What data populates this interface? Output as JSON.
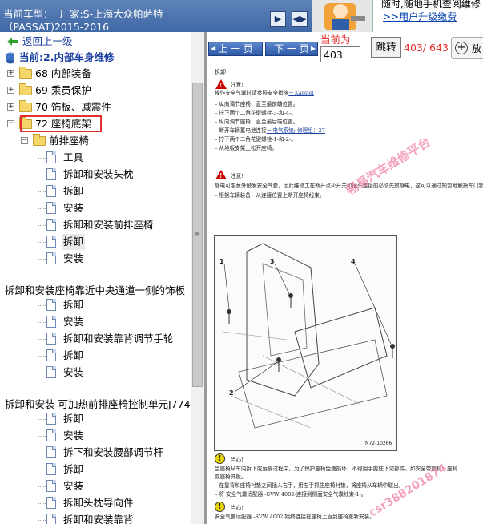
{
  "header": {
    "vehicle_line1": "当前车型：  厂家:S-上海大众帕萨特",
    "vehicle_line2": "（PASSAT)2015-2016",
    "promo_line1": "随时,随地手机查阅维修",
    "promo_line2": ">>用户升级缴费"
  },
  "tree": {
    "back_label": "返回上一级",
    "current_label": "当前:2.内部车身维修",
    "items": [
      {
        "label": "68 内部装备"
      },
      {
        "label": "69 乘员保护"
      },
      {
        "label": "70 饰板、减震件"
      },
      {
        "label": "72 座椅底架"
      },
      {
        "label": "前排座椅"
      },
      {
        "label": "工具"
      },
      {
        "label": "拆卸和安装头枕"
      },
      {
        "label": "拆卸"
      },
      {
        "label": "安装"
      },
      {
        "label": "拆卸和安装前排座椅"
      },
      {
        "label": "拆卸"
      },
      {
        "label": "安装"
      },
      {
        "label": "拆卸和安装座椅靠近中央通道一侧的饰板"
      },
      {
        "label": "拆卸"
      },
      {
        "label": "安装"
      },
      {
        "label": "拆卸和安装靠背调节手轮"
      },
      {
        "label": "拆卸"
      },
      {
        "label": "安装"
      },
      {
        "label": "拆卸和安装 可加热前排座椅控制单元J774"
      },
      {
        "label": "拆卸"
      },
      {
        "label": "安装"
      },
      {
        "label": "拆下和安装腰部调节杆"
      },
      {
        "label": "拆卸"
      },
      {
        "label": "安装"
      },
      {
        "label": "拆卸头枕导向件"
      },
      {
        "label": "拆卸和安装靠背"
      }
    ]
  },
  "pager": {
    "prev_label": "上 一 页",
    "next_label": "下 一 页",
    "current_label": "当前为",
    "page_value": "403",
    "jump_label": "跳转",
    "page_count": "403/ 643",
    "zoom_label": "放"
  },
  "document": {
    "heading": "拆卸",
    "caution1_title": "注意!",
    "caution1_text": "操作安全气囊时请参照安全措施",
    "caution1_link": "→ Kapitel",
    "steps1": [
      "–  纵向调节座椅，直至最前端位置。",
      "–  拧下两个二角花键螺栓-3-和-4-。",
      "–  纵向调节座椅，直至最后端位置。",
      "–  断开车辆蓄电池连接",
      "–  拧下两个二角花键螺栓-1-和-2-。",
      "–  从地板支架上松开座椅。"
    ],
    "battery_link": "→ 电气系统; 修理组：27",
    "caution2_title": "注意!",
    "caution2_text": "静电可能意外触发安全气囊，因此维修工在断开点火开关和插头连接前必须先放静电，这可以通过短暂地触摸车门锁扣来实现。",
    "step_connector": "–  根据车辆装备，从连接位置上断开座椅线束。",
    "figure_labels": [
      "1",
      "3",
      "4",
      "2"
    ],
    "figure_code": "N72-10266",
    "note1_title": "当心!",
    "note1_text1": "当座椅从车内拆下或运输过程中，为了保护座椅免遭损坏，不得用手握住下述部件，如安全带锁扣、座椅",
    "note1_text2": "或座椅饰板。",
    "steps2": [
      "–  在靠背和座椅衬垫之间插入右手，用左手抓住座椅衬垫，将座椅从车辆中取出。",
      "–  将 安全气囊适配器 -SVW 4002-连接到侧面安全气囊线束-1-。"
    ],
    "note2_title": "当心!",
    "note2_text": "安全气囊适配器 -SVW 4002-始终连接在座椅上直到座椅重新安装。",
    "watermark1": "畅易汽车维修平台",
    "watermark2": "csr388201874"
  },
  "colors": {
    "header_bg": "#4a72ad",
    "accent_red": "#e53030",
    "button_blue": "#3c66b0"
  }
}
